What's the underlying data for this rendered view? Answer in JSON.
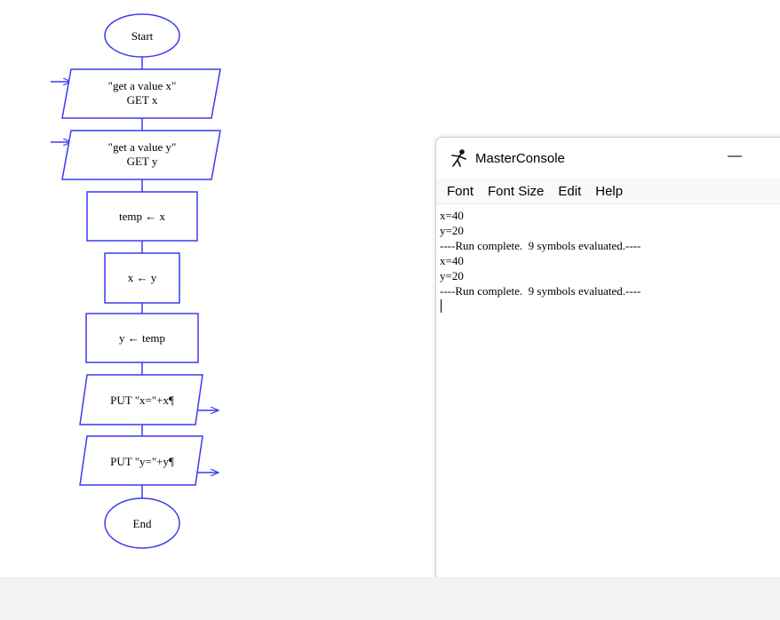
{
  "flowchart": {
    "start_label": "Start",
    "input_x": {
      "prompt": "\"get a value x\"",
      "command": "GET x"
    },
    "input_y": {
      "prompt": "\"get a value y\"",
      "command": "GET y"
    },
    "assign_temp": "temp ← x",
    "assign_x": "x ← y",
    "assign_y": "y ← temp",
    "output_x": "PUT \"x=\"+x¶",
    "output_y": "PUT \"y=\"+y¶",
    "end_label": "End",
    "colors": {
      "shape": "#3a3af0",
      "arrow": "#3a3af0"
    }
  },
  "console": {
    "title": "MasterConsole",
    "icon": "stick-figure-icon",
    "minimize_label": "—",
    "menu": [
      "Font",
      "Font Size",
      "Edit",
      "Help"
    ],
    "output_lines": [
      "x=40",
      "y=20",
      "----Run complete.  9 symbols evaluated.----",
      "x=40",
      "y=20",
      "----Run complete.  9 symbols evaluated.----"
    ]
  }
}
